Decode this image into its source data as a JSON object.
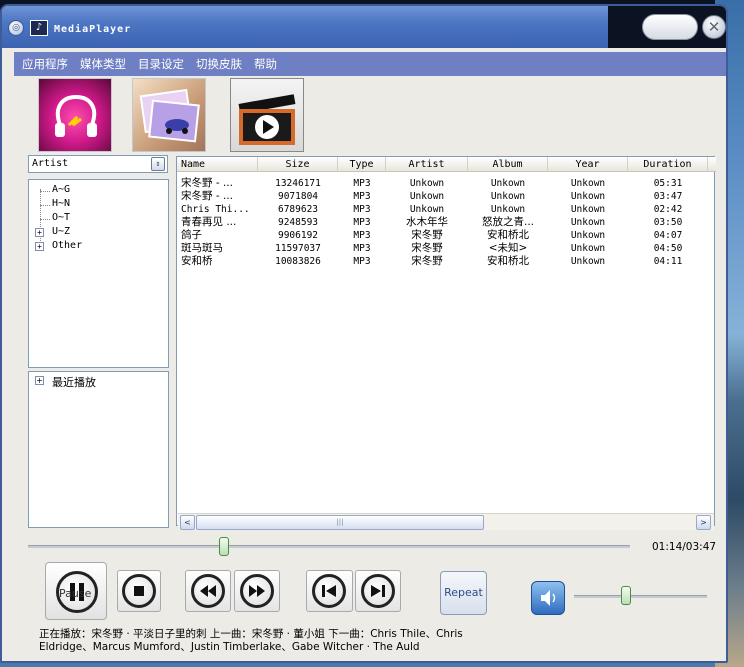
{
  "window": {
    "title": "MediaPlayer",
    "logo_glyph": "♪",
    "title_dot": "◎",
    "close_glyph": "✕"
  },
  "menu": [
    "应用程序",
    "媒体类型",
    "目录设定",
    "切换皮肤",
    "帮助"
  ],
  "toolbar": {
    "icons": [
      "headphone-icon",
      "photo-icon",
      "video-clapper-icon"
    ]
  },
  "left_panel": {
    "combo_value": "Artist",
    "combo_arrow": "⇕",
    "tree": [
      "A~G",
      "H~N",
      "O~T",
      "U~Z",
      "Other"
    ],
    "tree_expandable": [
      false,
      false,
      false,
      true,
      true
    ],
    "history_tree": [
      "最近播放"
    ]
  },
  "list": {
    "columns": [
      "Name",
      "Size",
      "Type",
      "Artist",
      "Album",
      "Year",
      "Duration"
    ],
    "rows": [
      {
        "name": "宋冬野 - ...",
        "size": "13246171",
        "type": "MP3",
        "artist": "Unkown",
        "album": "Unkown",
        "year": "Unkown",
        "duration": "05:31"
      },
      {
        "name": "宋冬野 - ...",
        "size": "9071804",
        "type": "MP3",
        "artist": "Unkown",
        "album": "Unkown",
        "year": "Unkown",
        "duration": "03:47"
      },
      {
        "name": "Chris Thi...",
        "size": "6789623",
        "type": "MP3",
        "artist": "Unkown",
        "album": "Unkown",
        "year": "Unkown",
        "duration": "02:42"
      },
      {
        "name": "青春再见 ...",
        "size": "9248593",
        "type": "MP3",
        "artist": "水木年华",
        "album": "怒放之青...",
        "year": "Unkown",
        "duration": "03:50"
      },
      {
        "name": "鸽子",
        "size": "9906192",
        "type": "MP3",
        "artist": "宋冬野",
        "album": "安和桥北",
        "year": "Unkown",
        "duration": "04:07"
      },
      {
        "name": "斑马斑马",
        "size": "11597037",
        "type": "MP3",
        "artist": "宋冬野",
        "album": "<未知>",
        "year": "Unkown",
        "duration": "04:50"
      },
      {
        "name": "安和桥",
        "size": "10083826",
        "type": "MP3",
        "artist": "宋冬野",
        "album": "安和桥北",
        "year": "Unkown",
        "duration": "04:11"
      }
    ],
    "hscroll": {
      "left": "<",
      "right": ">",
      "grip": "|||"
    }
  },
  "player": {
    "time": "01:14/03:47",
    "progress": 0.326,
    "play_label": "Pause",
    "repeat_label": "Repeat",
    "volume": 0.39,
    "now_playing": "正在播放：宋冬野 · 平淡日子里的刺  上一曲：宋冬野 · 董小姐  下一曲：Chris Thile、Chris Eldridge、Marcus Mumford、Justin Timberlake、Gabe Witcher · The Auld"
  }
}
